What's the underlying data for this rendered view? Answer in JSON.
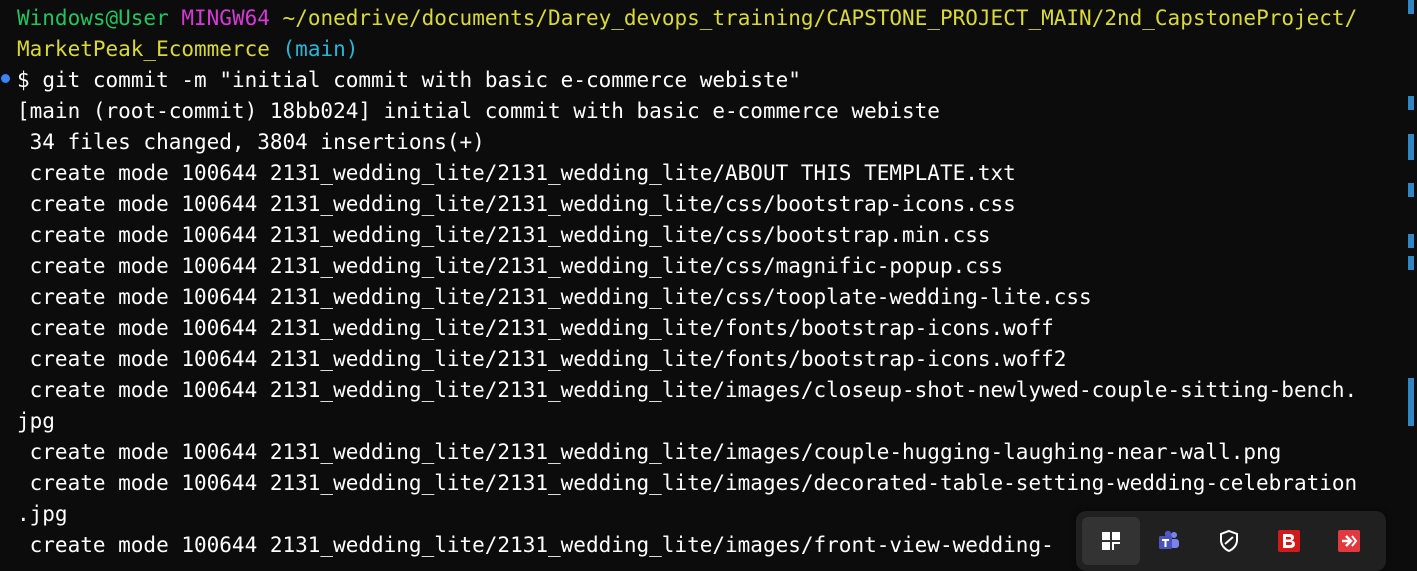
{
  "prompt": {
    "user_host": "Windows@User",
    "env": "MINGW64",
    "path": "~/onedrive/documents/Darey_devops_training/CAPSTONE_PROJECT_MAIN/2nd_CapstoneProject/",
    "path_cont": "MarketPeak_Ecommerce",
    "branch": "(main)",
    "symbol": "$",
    "command": "git commit -m \"initial commit with basic e-commerce webiste\""
  },
  "output": {
    "commit_line": "[main (root-commit) 18bb024] initial commit with basic e-commerce webiste",
    "summary": " 34 files changed, 3804 insertions(+)",
    "lines": [
      " create mode 100644 2131_wedding_lite/2131_wedding_lite/ABOUT THIS TEMPLATE.txt",
      " create mode 100644 2131_wedding_lite/2131_wedding_lite/css/bootstrap-icons.css",
      " create mode 100644 2131_wedding_lite/2131_wedding_lite/css/bootstrap.min.css",
      " create mode 100644 2131_wedding_lite/2131_wedding_lite/css/magnific-popup.css",
      " create mode 100644 2131_wedding_lite/2131_wedding_lite/css/tooplate-wedding-lite.css",
      " create mode 100644 2131_wedding_lite/2131_wedding_lite/fonts/bootstrap-icons.woff",
      " create mode 100644 2131_wedding_lite/2131_wedding_lite/fonts/bootstrap-icons.woff2",
      " create mode 100644 2131_wedding_lite/2131_wedding_lite/images/closeup-shot-newlywed-couple-sitting-bench.",
      "jpg",
      " create mode 100644 2131_wedding_lite/2131_wedding_lite/images/couple-hugging-laughing-near-wall.png",
      " create mode 100644 2131_wedding_lite/2131_wedding_lite/images/decorated-table-setting-wedding-celebration",
      ".jpg",
      " create mode 100644 2131_wedding_lite/2131_wedding_lite/images/front-view-wedding-"
    ]
  },
  "taskbar": {
    "icons": [
      "window-snap-icon",
      "teams-icon",
      "shield-icon",
      "app-b-icon",
      "remote-icon"
    ]
  },
  "colors": {
    "background": "#0c0c0c",
    "user_host": "#22c55e",
    "env": "#d63ad6",
    "path": "#d9d938",
    "branch": "#29b6d6",
    "text": "#ffffff",
    "scrollbar_marks": "#2f87c6"
  }
}
